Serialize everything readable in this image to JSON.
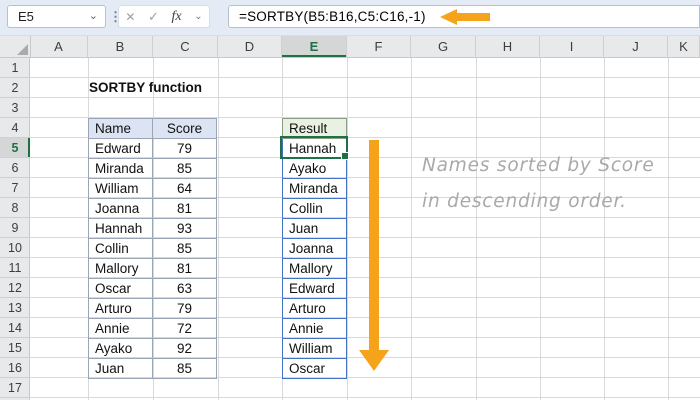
{
  "formula_bar": {
    "cell_reference": "E5",
    "formula": "=SORTBY(B5:B16,C5:C16,-1)",
    "icons": {
      "name_box_chevron": "⌄",
      "dots": "⋮",
      "cancel": "✕",
      "enter": "✓",
      "fx": "fx",
      "fx_chevron": "⌄"
    }
  },
  "sheet": {
    "title_cell": "SORTBY function",
    "column_letters": [
      "A",
      "B",
      "C",
      "D",
      "E",
      "F",
      "G",
      "H",
      "I",
      "J",
      "K"
    ],
    "row_numbers": [
      1,
      2,
      3,
      4,
      5,
      6,
      7,
      8,
      9,
      10,
      11,
      12,
      13,
      14,
      15,
      16,
      17
    ],
    "selected_column": "E",
    "selected_row": 5,
    "selected_cell": "E5"
  },
  "name_table": {
    "headers": [
      "Name",
      "Score"
    ],
    "rows": [
      [
        "Edward",
        79
      ],
      [
        "Miranda",
        85
      ],
      [
        "William",
        64
      ],
      [
        "Joanna",
        81
      ],
      [
        "Hannah",
        93
      ],
      [
        "Collin",
        85
      ],
      [
        "Mallory",
        81
      ],
      [
        "Oscar",
        63
      ],
      [
        "Arturo",
        79
      ],
      [
        "Annie",
        72
      ],
      [
        "Ayako",
        92
      ],
      [
        "Juan",
        85
      ]
    ]
  },
  "result_table": {
    "header": "Result",
    "values": [
      "Hannah",
      "Ayako",
      "Miranda",
      "Collin",
      "Juan",
      "Joanna",
      "Mallory",
      "Edward",
      "Arturo",
      "Annie",
      "William",
      "Oscar"
    ]
  },
  "annotation": {
    "line1": "Names sorted by Score",
    "line2": "in descending order."
  },
  "colors": {
    "selection_green": "#1E7145",
    "spill_border_blue": "#4472C4",
    "arrow_orange": "#F6A31C",
    "name_header_bg": "#DCE3F2",
    "result_header_bg": "#EAF1E2",
    "formula_bar_bg": "#E4EBF4"
  }
}
